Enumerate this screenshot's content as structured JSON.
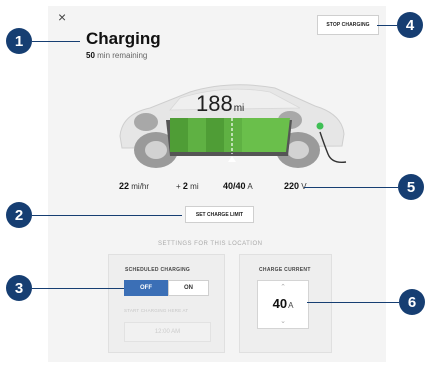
{
  "header": {
    "close_label": "×",
    "title": "Charging",
    "remaining_value": "50",
    "remaining_text": "min remaining",
    "stop_label": "STOP CHARGING"
  },
  "battery": {
    "range_value": "188",
    "range_unit": "mi"
  },
  "stats": {
    "rate_value": "22",
    "rate_unit": "mi/hr",
    "added_prefix": "+",
    "added_value": "2",
    "added_unit": "mi",
    "current_value": "40/40",
    "current_unit": "A",
    "voltage_value": "220",
    "voltage_unit": "V"
  },
  "limit": {
    "button_label": "SET CHARGE LIMIT"
  },
  "settings": {
    "title": "SETTINGS FOR THIS LOCATION",
    "scheduled": {
      "label": "SCHEDULED CHARGING",
      "off_label": "OFF",
      "on_label": "ON",
      "start_label": "START CHARGING HERE AT",
      "time_value": "12:00 AM"
    },
    "current": {
      "label": "CHARGE CURRENT",
      "value": "40",
      "unit": "A"
    }
  },
  "callouts": [
    "1",
    "2",
    "3",
    "4",
    "5",
    "6"
  ],
  "colors": {
    "accent": "#3b6fb6",
    "callout": "#163e72",
    "battery_green": "#6abf4b"
  },
  "icons": [
    "close-icon",
    "car-icon",
    "charge-plug-icon",
    "chevron-up-icon",
    "chevron-down-icon"
  ]
}
